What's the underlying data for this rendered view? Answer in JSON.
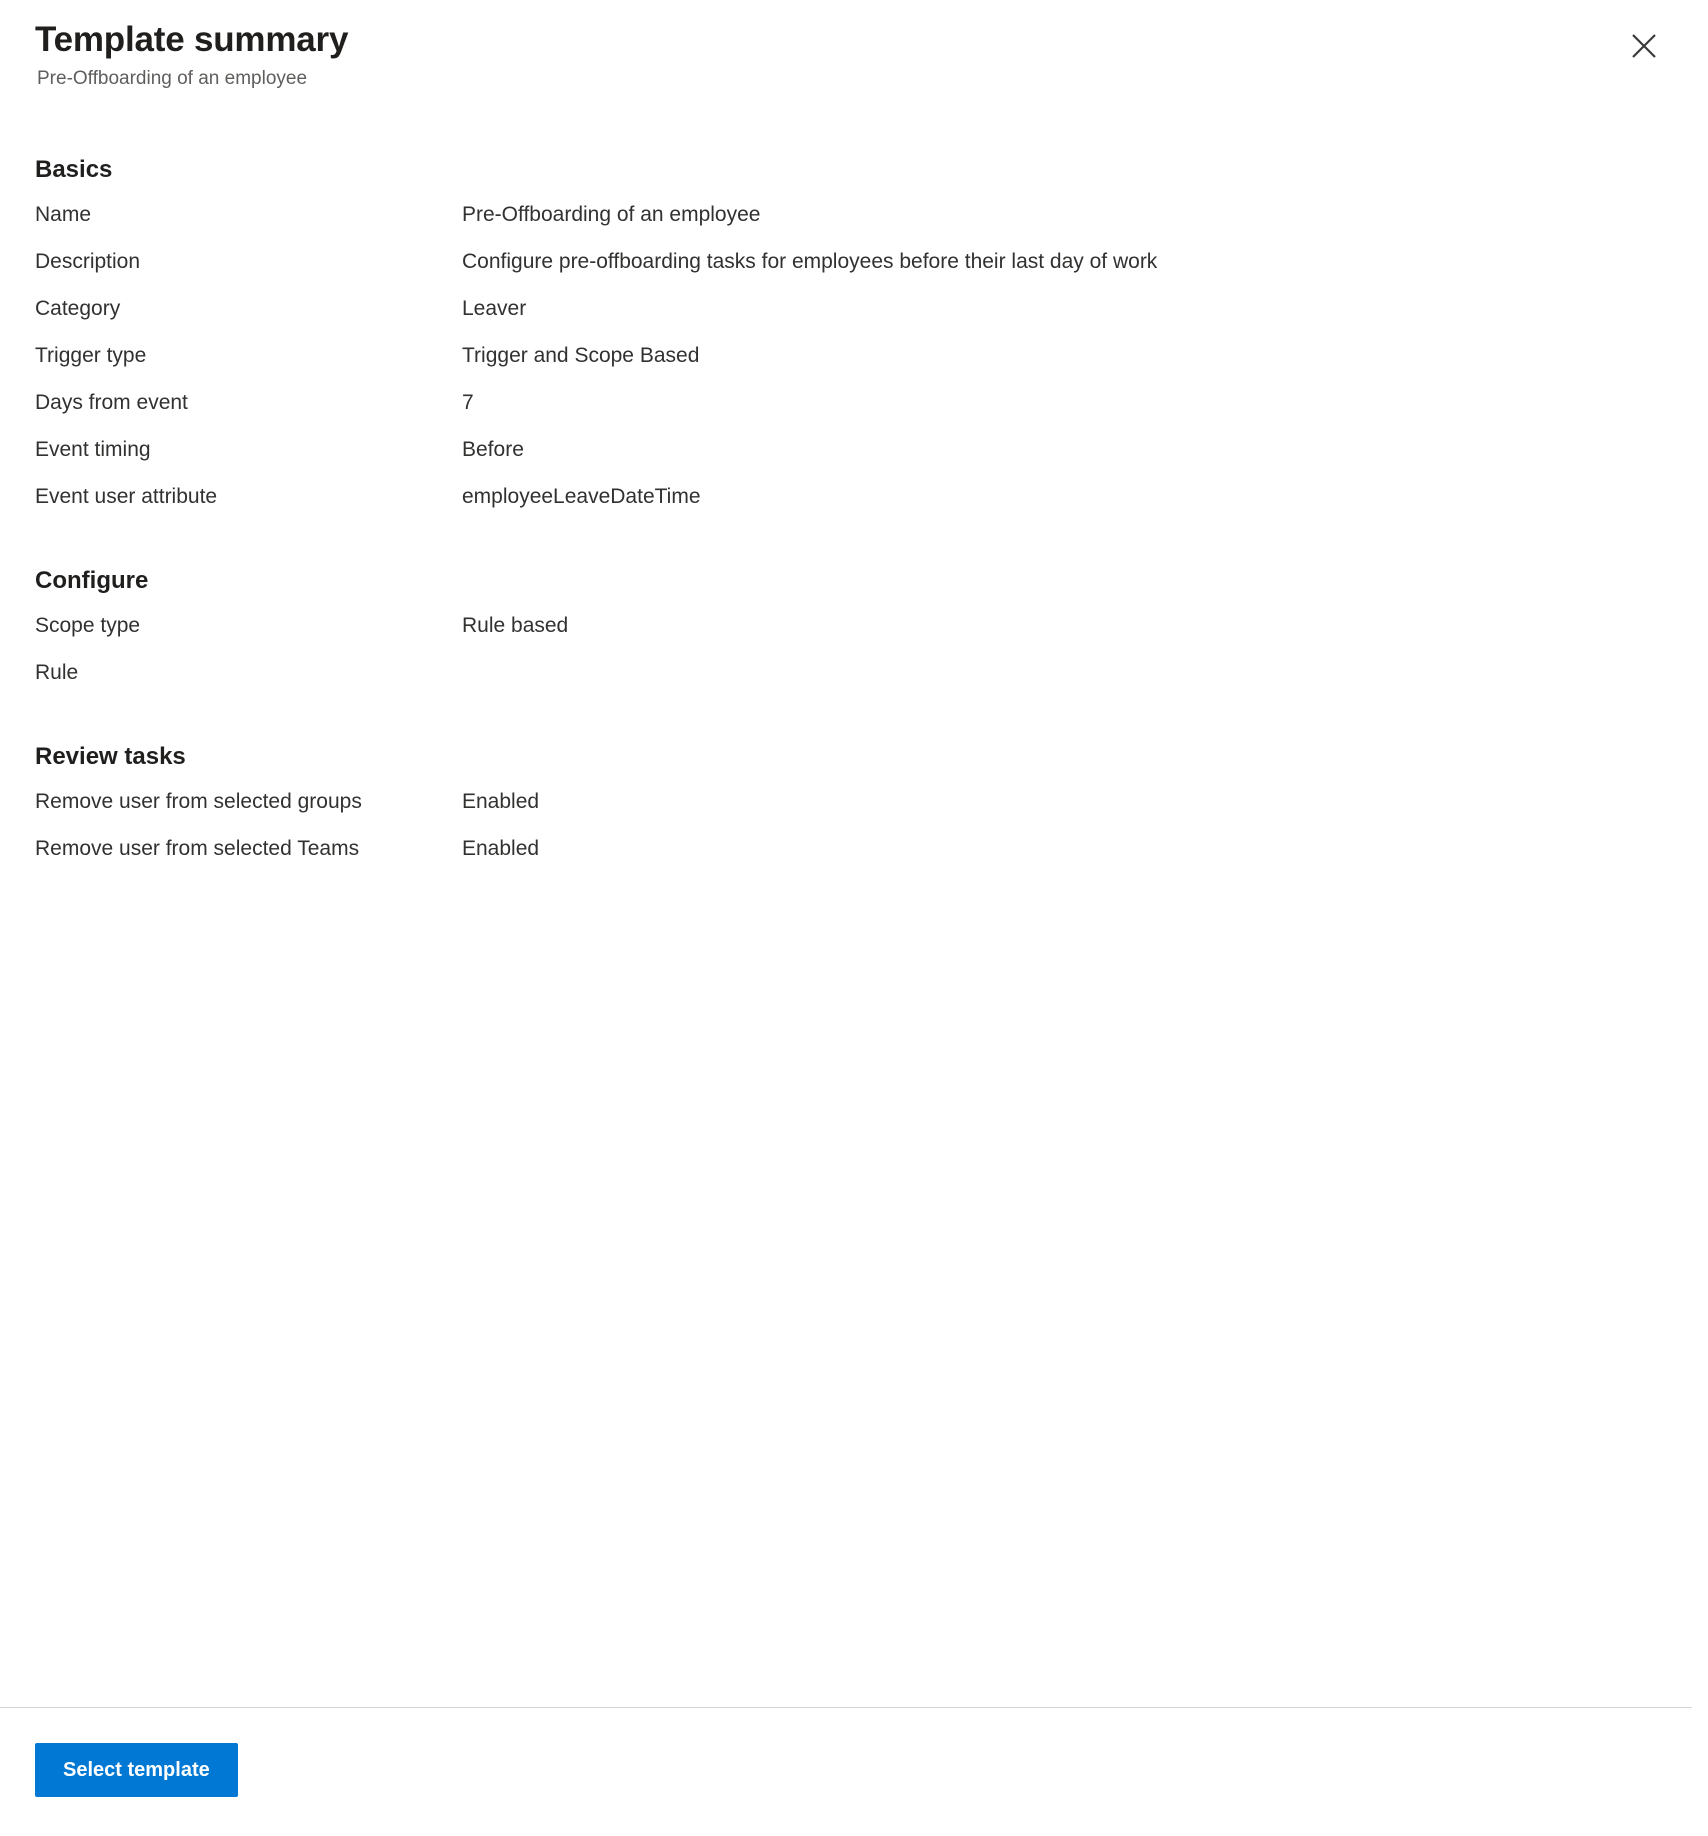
{
  "header": {
    "title": "Template summary",
    "subtitle": "Pre-Offboarding of an employee",
    "close_icon": "close-icon"
  },
  "sections": [
    {
      "key": "basics",
      "heading": "Basics",
      "rows": [
        {
          "label": "Name",
          "value": "Pre-Offboarding of an employee"
        },
        {
          "label": "Description",
          "value": "Configure pre-offboarding tasks for employees before their last day of work"
        },
        {
          "label": "Category",
          "value": "Leaver"
        },
        {
          "label": "Trigger type",
          "value": "Trigger and Scope Based"
        },
        {
          "label": "Days from event",
          "value": "7"
        },
        {
          "label": "Event timing",
          "value": "Before"
        },
        {
          "label": "Event user attribute",
          "value": "employeeLeaveDateTime"
        }
      ]
    },
    {
      "key": "configure",
      "heading": "Configure",
      "rows": [
        {
          "label": "Scope type",
          "value": "Rule based"
        },
        {
          "label": "Rule",
          "value": ""
        }
      ]
    },
    {
      "key": "review_tasks",
      "heading": "Review tasks",
      "rows": [
        {
          "label": "Remove user from selected groups",
          "value": "Enabled"
        },
        {
          "label": "Remove user from selected Teams",
          "value": "Enabled"
        }
      ]
    }
  ],
  "footer": {
    "primary_button_label": "Select template"
  },
  "colors": {
    "accent": "#0078d4",
    "title_text": "#201f1e",
    "body_text": "#323130",
    "subtitle_text": "#605e5c",
    "divider": "#d6d6d6",
    "background": "#ffffff"
  }
}
